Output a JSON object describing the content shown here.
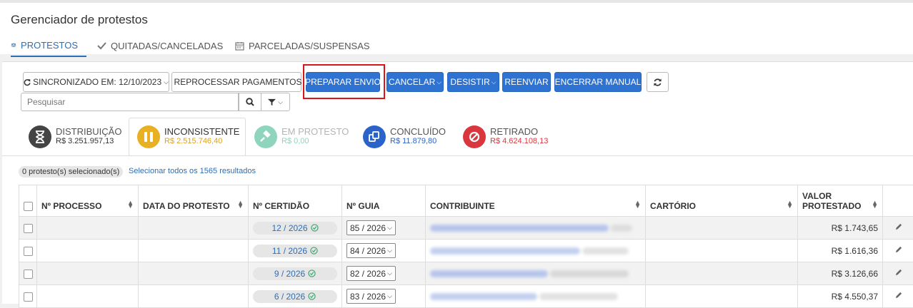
{
  "header": {
    "title": "Gerenciador de protestos",
    "tabs": [
      {
        "label": "PROTESTOS",
        "icon": "scale-icon"
      },
      {
        "label": "QUITADAS/CANCELADAS",
        "icon": "check-icon"
      },
      {
        "label": "PARCELADAS/SUSPENSAS",
        "icon": "calendar-icon"
      }
    ]
  },
  "toolbar": {
    "sync_label": "SINCRONIZADO EM: 12/10/2023",
    "reprocess_label": "REPROCESSAR PAGAMENTOS",
    "prepare_label": "PREPARAR ENVIO",
    "cancel_label": "CANCELAR",
    "desist_label": "DESISTIR",
    "resend_label": "REENVIAR",
    "close_manual_label": "ENCERRAR MANUAL",
    "refresh_icon": "refresh-icon"
  },
  "search": {
    "placeholder": "Pesquisar"
  },
  "statuses": [
    {
      "label": "DISTRIBUIÇÃO",
      "value": "R$ 3.251.957,13",
      "color": "#444444",
      "icon": "hourglass-icon"
    },
    {
      "label": "INCONSISTENTE",
      "value": "R$ 2.515.746,40",
      "color": "#e8b123",
      "icon": "pause-icon"
    },
    {
      "label": "EM PROTESTO",
      "value": "R$ 0,00",
      "color": "#8fd4bd",
      "icon": "gavel-icon"
    },
    {
      "label": "CONCLUÍDO",
      "value": "R$ 11.879,80",
      "color": "#2a63c9",
      "icon": "copy-icon"
    },
    {
      "label": "RETIRADO",
      "value": "R$ 4.624.108,13",
      "color": "#d9363e",
      "icon": "ban-icon"
    }
  ],
  "selection": {
    "count_text": "0 protesto(s) selecionado(s)",
    "select_all_text": "Selecionar todos os 1565 resultados"
  },
  "table": {
    "columns": [
      "Nº PROCESSO",
      "DATA DO PROTESTO",
      "Nº CERTIDÃO",
      "Nº GUIA",
      "CONTRIBUINTE",
      "CARTÓRIO",
      "VALOR\nPROTESTADO"
    ],
    "rows": [
      {
        "certidao": "12 / 2026",
        "guia": "85 / 2026",
        "valor": "R$ 1.743,65"
      },
      {
        "certidao": "11 / 2026",
        "guia": "84 / 2026",
        "valor": "R$ 1.616,36"
      },
      {
        "certidao": "9 / 2026",
        "guia": "82 / 2026",
        "valor": "R$ 3.126,66"
      },
      {
        "certidao": "6 / 2026",
        "guia": "83 / 2026",
        "valor": "R$ 4.550,37"
      }
    ]
  }
}
